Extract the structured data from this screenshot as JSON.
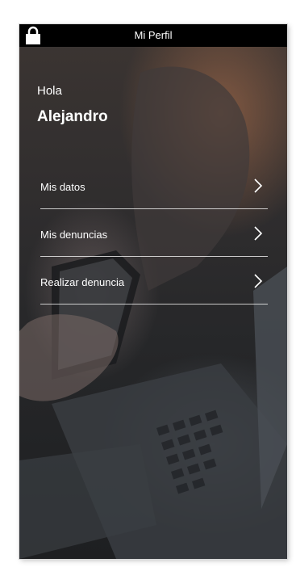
{
  "header": {
    "title": "Mi Perfil",
    "lock_icon": "lock-icon"
  },
  "profile": {
    "greeting": "Hola",
    "name": "Alejandro"
  },
  "menu": {
    "items": [
      {
        "label": "Mis datos",
        "icon": "chevron-right-icon"
      },
      {
        "label": "Mis denuncias",
        "icon": "chevron-right-icon"
      },
      {
        "label": "Realizar denuncia",
        "icon": "chevron-right-icon"
      }
    ]
  },
  "colors": {
    "text": "#ffffff",
    "statusbar": "#000000",
    "divider": "#ffffff"
  }
}
